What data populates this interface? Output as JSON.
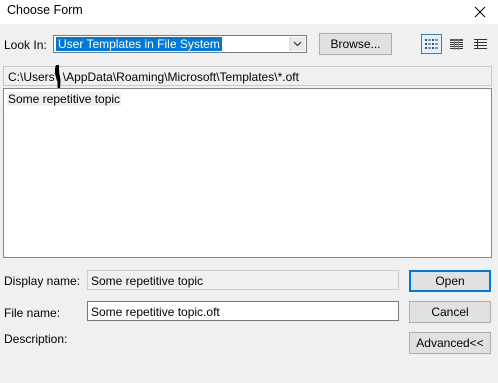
{
  "window": {
    "title": "Choose Form"
  },
  "look_in": {
    "label": "Look In:",
    "selected": "User Templates in File System",
    "browse_label": "Browse..."
  },
  "view_buttons": [
    {
      "icon": "list-view-icon",
      "selected": true
    },
    {
      "icon": "details-view-icon",
      "selected": false
    },
    {
      "icon": "large-icons-view-icon",
      "selected": false
    }
  ],
  "path": "C:\\Users\\  \\AppData\\Roaming\\Microsoft\\Templates\\*.oft",
  "files": [
    {
      "name": "Some repetitive topic"
    }
  ],
  "display_name": {
    "label": "Display name:",
    "value": "Some repetitive topic"
  },
  "file_name": {
    "label": "File name:",
    "value": "Some repetitive topic.oft"
  },
  "description": {
    "label": "Description:"
  },
  "buttons": {
    "open": "Open",
    "cancel": "Cancel",
    "advanced": "Advanced<<"
  }
}
